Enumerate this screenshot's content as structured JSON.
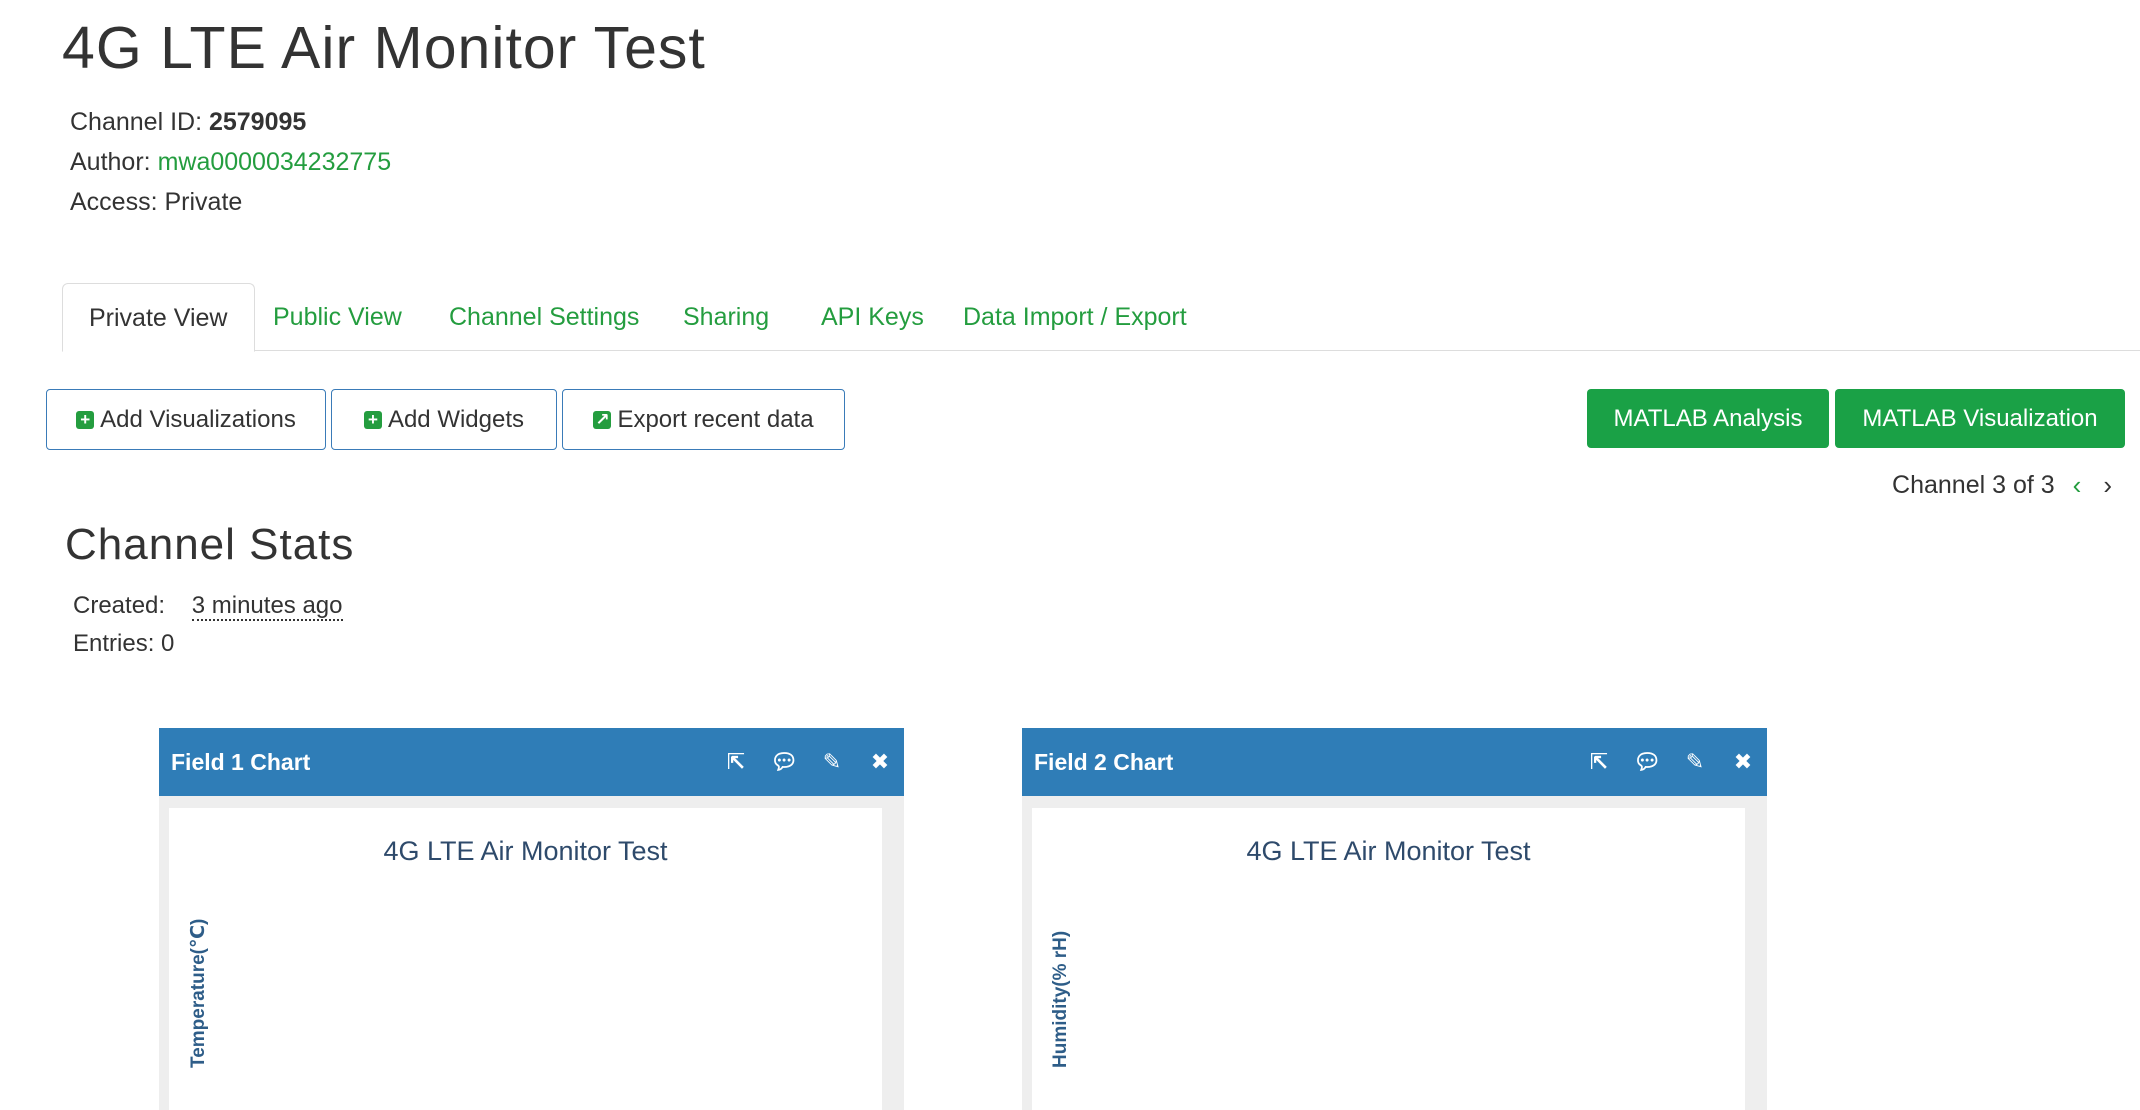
{
  "header": {
    "title": "4G LTE Air Monitor Test",
    "channel_id_label": "Channel ID: ",
    "channel_id_value": "2579095",
    "author_label": "Author: ",
    "author_value": "mwa0000034232775",
    "access_label": "Access: ",
    "access_value": "Private"
  },
  "tabs": [
    {
      "label": "Private View",
      "active": true
    },
    {
      "label": "Public View"
    },
    {
      "label": "Channel Settings"
    },
    {
      "label": "Sharing"
    },
    {
      "label": "API Keys"
    },
    {
      "label": "Data Import / Export"
    }
  ],
  "actions": {
    "add_visualizations": "Add Visualizations",
    "add_widgets": "Add Widgets",
    "export_recent": "Export recent data",
    "matlab_analysis": "MATLAB Analysis",
    "matlab_visualization": "MATLAB Visualization"
  },
  "channel_nav": {
    "text": "Channel 3 of 3",
    "prev_glyph": "‹",
    "next_glyph": "›"
  },
  "stats": {
    "title": "Channel Stats",
    "created_label": "Created:",
    "created_value": "3 minutes ago",
    "entries_label": "Entries: ",
    "entries_value": "0"
  },
  "panels": [
    {
      "name": "Field 1 Chart",
      "chart_title": "4G LTE Air Monitor Test",
      "y_label": "Temperature(℃)"
    },
    {
      "name": "Field 2 Chart",
      "chart_title": "4G LTE Air Monitor Test",
      "y_label": "Humidity(% rH)"
    }
  ],
  "colors": {
    "accent_green": "#249d3f",
    "button_green": "#1aa146",
    "panel_blue": "#2f7db7"
  }
}
